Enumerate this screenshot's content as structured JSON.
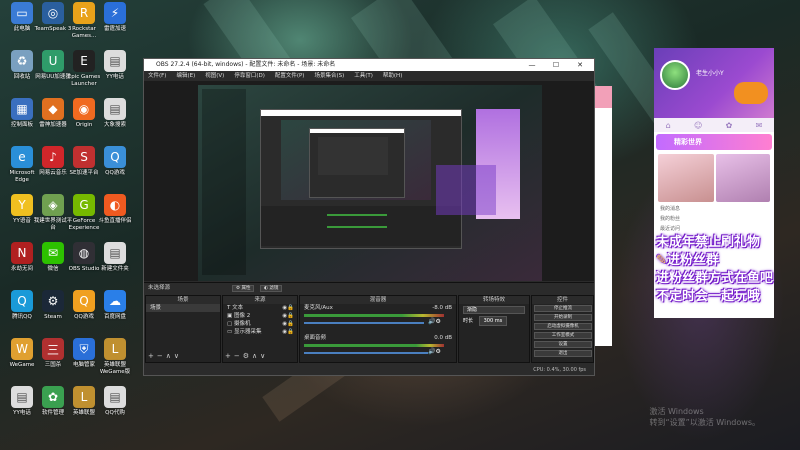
{
  "desktop_icons": [
    {
      "label": "此电脑",
      "icon": "computer-icon",
      "color": "#3a7bd5"
    },
    {
      "label": "TeamSpeak 3",
      "icon": "teamspeak-icon",
      "color": "#2a5f9e"
    },
    {
      "label": "Rockstar Games...",
      "icon": "rockstar-icon",
      "color": "#e8a21a"
    },
    {
      "label": "雷霆加速",
      "icon": "thunder-icon",
      "color": "#2a6fd8"
    },
    {
      "label": "回收站",
      "icon": "recycle-bin-icon",
      "color": "#7aa0c0"
    },
    {
      "label": "网易UU加速器",
      "icon": "uu-icon",
      "color": "#2f9c6a"
    },
    {
      "label": "Epic Games Launcher",
      "icon": "epic-icon",
      "color": "#222222"
    },
    {
      "label": "YY电话",
      "icon": "file-icon",
      "color": "#dddddd"
    },
    {
      "label": "控制面板",
      "icon": "control-panel-icon",
      "color": "#3a6fbf"
    },
    {
      "label": "雷神加速器",
      "icon": "leishen-icon",
      "color": "#e07020"
    },
    {
      "label": "Origin",
      "icon": "origin-icon",
      "color": "#f06a20"
    },
    {
      "label": "大象搜索",
      "icon": "file-icon",
      "color": "#dddddd"
    },
    {
      "label": "Microsoft Edge",
      "icon": "edge-icon",
      "color": "#2a8fd8"
    },
    {
      "label": "网易云音乐",
      "icon": "netease-music-icon",
      "color": "#d0262a"
    },
    {
      "label": "SE加速平台",
      "icon": "se-icon",
      "color": "#c03030"
    },
    {
      "label": "QQ游戏",
      "icon": "qq-game-icon",
      "color": "#3a8fd8"
    },
    {
      "label": "YY语音",
      "icon": "yy-icon",
      "color": "#f0c020"
    },
    {
      "label": "我建世界测试平台",
      "icon": "world-icon",
      "color": "#70a050"
    },
    {
      "label": "GeForce Experience",
      "icon": "geforce-icon",
      "color": "#76b900"
    },
    {
      "label": "斗鱼直播伴侣",
      "icon": "douyu-icon",
      "color": "#f05a20"
    },
    {
      "label": "永劫无间",
      "icon": "naraka-icon",
      "color": "#b02020"
    },
    {
      "label": "微信",
      "icon": "wechat-icon",
      "color": "#2dc100"
    },
    {
      "label": "OBS Studio",
      "icon": "obs-icon",
      "color": "#302f35"
    },
    {
      "label": "新建文件夹",
      "icon": "file-icon",
      "color": "#dddddd"
    },
    {
      "label": "腾讯QQ",
      "icon": "qq-icon",
      "color": "#1a9ad8"
    },
    {
      "label": "Steam",
      "icon": "steam-icon",
      "color": "#1b2838"
    },
    {
      "label": "QQ游戏",
      "icon": "qq-game-icon",
      "color": "#f0a020"
    },
    {
      "label": "百度网盘",
      "icon": "baidu-disk-icon",
      "color": "#2a7fe8"
    },
    {
      "label": "WeGame",
      "icon": "wegame-icon",
      "color": "#e0a030"
    },
    {
      "label": "三国杀",
      "icon": "sanguosha-icon",
      "color": "#b03030"
    },
    {
      "label": "电脑管家",
      "icon": "pc-manager-icon",
      "color": "#2a6fd8"
    },
    {
      "label": "英雄联盟WeGame版",
      "icon": "lol-icon",
      "color": "#c09030"
    },
    {
      "label": "YY电话",
      "icon": "file-icon",
      "color": "#dddddd"
    },
    {
      "label": "软件管理",
      "icon": "software-icon",
      "color": "#3aa050"
    },
    {
      "label": "英雄联盟",
      "icon": "lol-icon",
      "color": "#c09030"
    },
    {
      "label": "QQ代购",
      "icon": "file-icon",
      "color": "#dddddd"
    }
  ],
  "obs": {
    "title": "OBS 27.2.4 (64-bit, windows) - 配置文件: 未命名 - 场景: 未命名",
    "minimize": "—",
    "maximize": "☐",
    "close": "✕",
    "menu": [
      "文件(F)",
      "编辑(E)",
      "视图(V)",
      "停靠窗口(D)",
      "配置文件(P)",
      "场景集合(S)",
      "工具(T)",
      "帮助(H)"
    ],
    "no_source_selected": "未选择源",
    "properties_btn": "属性",
    "filters_btn": "滤镜",
    "panels": {
      "scenes": {
        "title": "场景",
        "items": [
          "场景"
        ]
      },
      "sources": {
        "title": "来源",
        "items": [
          "文本",
          "图像 2",
          "摄像机",
          "显示器采集"
        ]
      },
      "mixer": {
        "title": "混音器",
        "channels": [
          {
            "name": "麦克风/Aux",
            "db": "-8.0 dB"
          },
          {
            "name": "桌面音频",
            "db": "0.0 dB"
          }
        ]
      },
      "transitions": {
        "title": "转场特效",
        "type": "渐隐",
        "duration_label": "时长",
        "duration": "300 ms"
      },
      "controls": {
        "title": "控件",
        "buttons": [
          "停止推流",
          "开始录制",
          "启动虚拟摄像机",
          "工作室模式",
          "设置",
          "退出"
        ]
      }
    },
    "status": "CPU: 0.4%, 30.00 fps"
  },
  "stream_app": {
    "user": "老生小小Y",
    "banner": "精彩世界",
    "menu": [
      "我的消息",
      "我的粉丝",
      "最近访问"
    ]
  },
  "overlay_lines": [
    "未成年禁止刷礼物",
    "进粉丝群",
    "进粉丝群方式在鱼吧",
    "不定时会一起玩哦"
  ],
  "watermark": [
    "激活 Windows",
    "转到“设置”以激活 Windows。"
  ]
}
